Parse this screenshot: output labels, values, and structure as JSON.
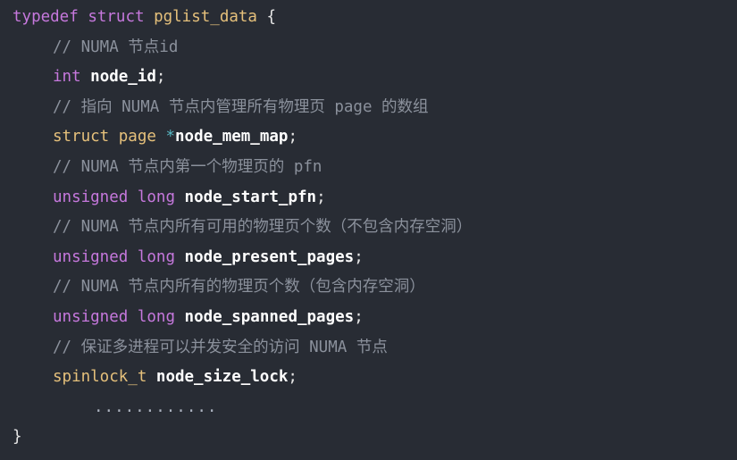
{
  "code": {
    "line1": {
      "kw1": "typedef",
      "kw2": "struct",
      "name": "pglist_data",
      "brace": "{"
    },
    "line2": {
      "comment": "// NUMA 节点id"
    },
    "line3": {
      "type": "int",
      "id": "node_id",
      "semi": ";"
    },
    "line4": {
      "comment": "// 指向 NUMA 节点内管理所有物理页 page 的数组"
    },
    "line5": {
      "kw": "struct",
      "type": "page",
      "star": "*",
      "id": "node_mem_map",
      "semi": ";"
    },
    "line6": {
      "comment": "// NUMA 节点内第一个物理页的 pfn"
    },
    "line7": {
      "kw1": "unsigned",
      "kw2": "long",
      "id": "node_start_pfn",
      "semi": ";"
    },
    "line8": {
      "comment": "// NUMA 节点内所有可用的物理页个数（不包含内存空洞）"
    },
    "line9": {
      "kw1": "unsigned",
      "kw2": "long",
      "id": "node_present_pages",
      "semi": ";"
    },
    "line10": {
      "comment": "// NUMA 节点内所有的物理页个数（包含内存空洞）"
    },
    "line11": {
      "kw1": "unsigned",
      "kw2": "long",
      "id": "node_spanned_pages",
      "semi": ";"
    },
    "line12": {
      "comment": "// 保证多进程可以并发安全的访问 NUMA 节点"
    },
    "line13": {
      "type": "spinlock_t",
      "id": "node_size_lock",
      "semi": ";"
    },
    "line14": {
      "dots": "............"
    },
    "line15": {
      "brace": "}"
    }
  },
  "colors": {
    "background": "#282c34",
    "keyword": "#c678dd",
    "type_highlight": "#e5c07b",
    "identifier": "#ffffff",
    "comment": "#8b919c"
  }
}
